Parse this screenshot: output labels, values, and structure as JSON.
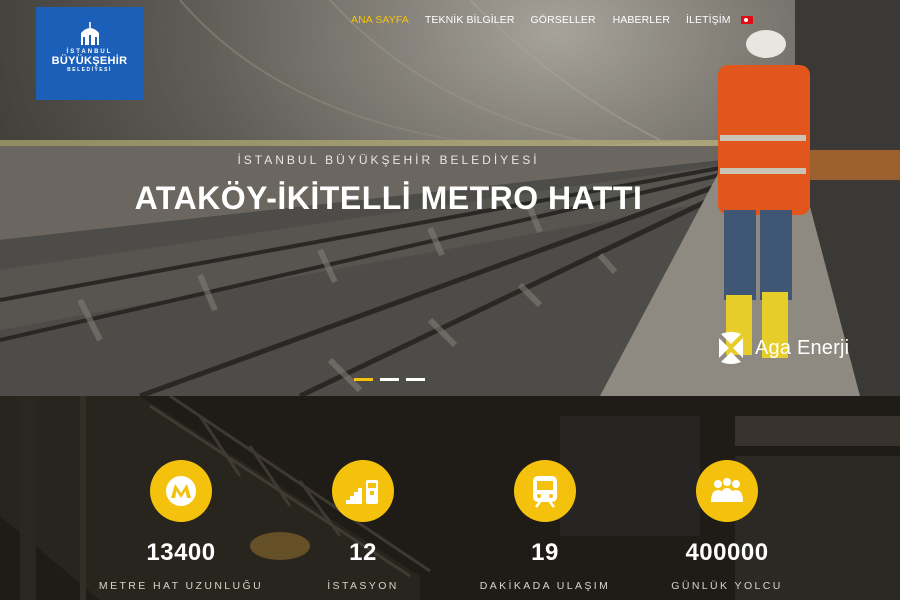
{
  "header": {
    "logo": {
      "line1": "İSTANBUL",
      "line2": "BÜYÜKŞEHİR",
      "line3": "BELEDİYESİ"
    },
    "nav": [
      {
        "label": "ANA SAYFA",
        "active": true
      },
      {
        "label": "TEKNİK BİLGİLER",
        "active": false
      },
      {
        "label": "GÖRSELLER",
        "active": false
      },
      {
        "label": "HABERLER",
        "active": false
      },
      {
        "label": "İLETİŞİM",
        "active": false
      }
    ],
    "language_flag": "turkey-flag-icon"
  },
  "hero": {
    "subtitle": "İSTANBUL BÜYÜKŞEHİR BELEDİYESİ",
    "title": "ATAKÖY-İKİTELLİ METRO HATTI",
    "sponsor": "Aga Enerji",
    "slides": 3,
    "active_slide": 1
  },
  "stats": [
    {
      "icon": "metro-icon",
      "value": "13400",
      "label": "METRE HAT UZUNLUĞU"
    },
    {
      "icon": "station-icon",
      "value": "12",
      "label": "İSTASYON"
    },
    {
      "icon": "train-icon",
      "value": "19",
      "label": "DAKİKADA ULAŞIM"
    },
    {
      "icon": "passengers-icon",
      "value": "400000",
      "label": "GÜNLÜK YOLCU"
    }
  ],
  "colors": {
    "accent": "#f4c20d",
    "logo_blue": "#1c5fb8",
    "flag_red": "#e30a17"
  }
}
